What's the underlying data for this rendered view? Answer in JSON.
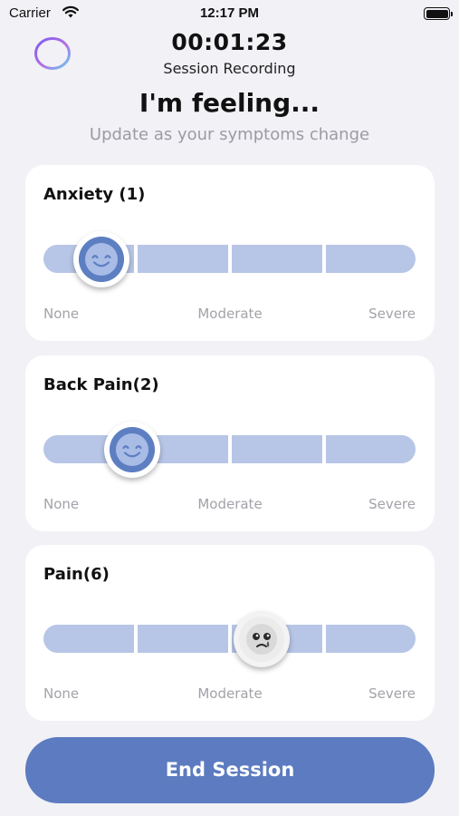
{
  "status_bar": {
    "carrier": "Carrier",
    "time": "12:17 PM"
  },
  "header": {
    "timer": "00:01:23",
    "session_label": "Session Recording",
    "title": "I'm feeling...",
    "subtitle": "Update as your symptoms change"
  },
  "symptoms": [
    {
      "name": "Anxiety (1)",
      "level": 1,
      "face": "smiling-face-icon",
      "scale": {
        "low": "None",
        "mid": "Moderate",
        "high": "Severe"
      }
    },
    {
      "name": "Back Pain(2)",
      "level": 2,
      "face": "smiling-face-icon",
      "scale": {
        "low": "None",
        "mid": "Moderate",
        "high": "Severe"
      }
    },
    {
      "name": "Pain(6)",
      "level": 6,
      "face": "crying-face-icon",
      "scale": {
        "low": "None",
        "mid": "Moderate",
        "high": "Severe"
      }
    }
  ],
  "footer": {
    "end_session_label": "End Session"
  },
  "colors": {
    "accent": "#5c7bc0",
    "track": "#b7c5e6",
    "background": "#f1f1f6",
    "muted_text": "#9b9ba3"
  }
}
